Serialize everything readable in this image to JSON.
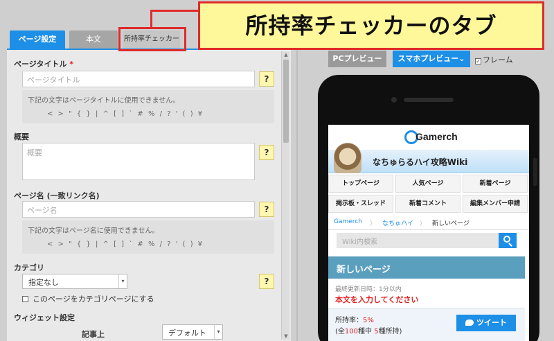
{
  "annotation": {
    "callout": "所持率チェッカーのタブ"
  },
  "tabs": [
    {
      "label": "ページ設定"
    },
    {
      "label": "本文"
    },
    {
      "label": "所持率チェッカー"
    }
  ],
  "editor": {
    "page_title": {
      "label": "ページタイトル",
      "required_mark": "*",
      "placeholder": "ページタイトル",
      "note": "下記の文字はページタイトルに使用できません。",
      "chars": "< > \" { } | ^ [ ] ` # % / ? ' ( ) ¥"
    },
    "summary": {
      "label": "概要",
      "placeholder": "概要"
    },
    "page_name": {
      "label": "ページ名 (一致リンク名)",
      "placeholder": "ページ名",
      "note": "下記の文字はページ名に使用できません。",
      "chars": "< > \" { } | ^ [ ] ` # % / ? ' ( ) ¥"
    },
    "category": {
      "label": "カテゴリ",
      "selected": "指定なし",
      "checkbox_label": "このページをカテゴリページにする"
    },
    "widget": {
      "label": "ウィジェット設定",
      "sub_label": "記事上",
      "selected": "デフォルト"
    },
    "help_mark": "?"
  },
  "preview": {
    "pc_label": "PCプレビュー",
    "sp_label": "スマホプレビュー",
    "frame_label": "フレーム",
    "site": {
      "logo": "Gamerch",
      "title": "なちゅらるハイ攻略Wiki",
      "nav": [
        "トップページ",
        "人気ページ",
        "新着ページ",
        "掲示板・スレッド",
        "新着コメント",
        "編集メンバー申請"
      ],
      "breadcrumb": [
        "Gamerch",
        "なちゅハイ",
        "新しいページ"
      ],
      "search_placeholder": "Wiki内検索",
      "page_heading": "新しいページ",
      "updated": "最終更新日時：1分以内",
      "warning": "本文を入力してください",
      "rate_label": "所持率：",
      "rate_value": "5%",
      "rate_detail_pre": "(全",
      "rate_total": "100",
      "rate_detail_mid": "種中 ",
      "rate_owned": "5",
      "rate_detail_post": "種所持)",
      "tweet": "ツイート"
    }
  },
  "colors": {
    "accent": "#1e8fe6",
    "highlight": "#e02a2a",
    "callout_bg": "#fff89a"
  }
}
